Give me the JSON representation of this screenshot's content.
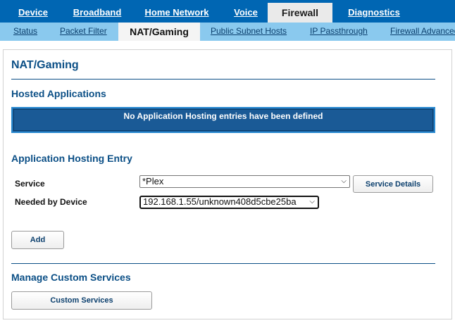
{
  "topnav": {
    "tabs": [
      {
        "label": "Device",
        "active": false
      },
      {
        "label": "Broadband",
        "active": false
      },
      {
        "label": "Home Network",
        "active": false
      },
      {
        "label": "Voice",
        "active": false
      },
      {
        "label": "Firewall",
        "active": true
      },
      {
        "label": "Diagnostics",
        "active": false
      }
    ]
  },
  "subnav": {
    "tabs": [
      {
        "label": "Status",
        "active": false
      },
      {
        "label": "Packet Filter",
        "active": false
      },
      {
        "label": "NAT/Gaming",
        "active": true
      },
      {
        "label": "Public Subnet Hosts",
        "active": false
      },
      {
        "label": "IP Passthrough",
        "active": false
      },
      {
        "label": "Firewall Advanced",
        "active": false
      }
    ]
  },
  "page": {
    "title": "NAT/Gaming"
  },
  "hosted_applications": {
    "title": "Hosted Applications",
    "empty_message": "No Application Hosting entries have been defined"
  },
  "hosting_entry": {
    "title": "Application Hosting Entry",
    "service_label": "Service",
    "service_value": "*Plex",
    "service_details_label": "Service Details",
    "device_label": "Needed by Device",
    "device_value": "192.168.1.55/unknown408d5cbe25ba",
    "add_label": "Add"
  },
  "custom_services": {
    "title": "Manage Custom Services",
    "button_label": "Custom Services"
  },
  "colors": {
    "nav_blue": "#0066b3",
    "subnav_blue": "#8ac9ee",
    "heading_blue": "#0b4f86",
    "banner_blue": "#1a5a96"
  }
}
